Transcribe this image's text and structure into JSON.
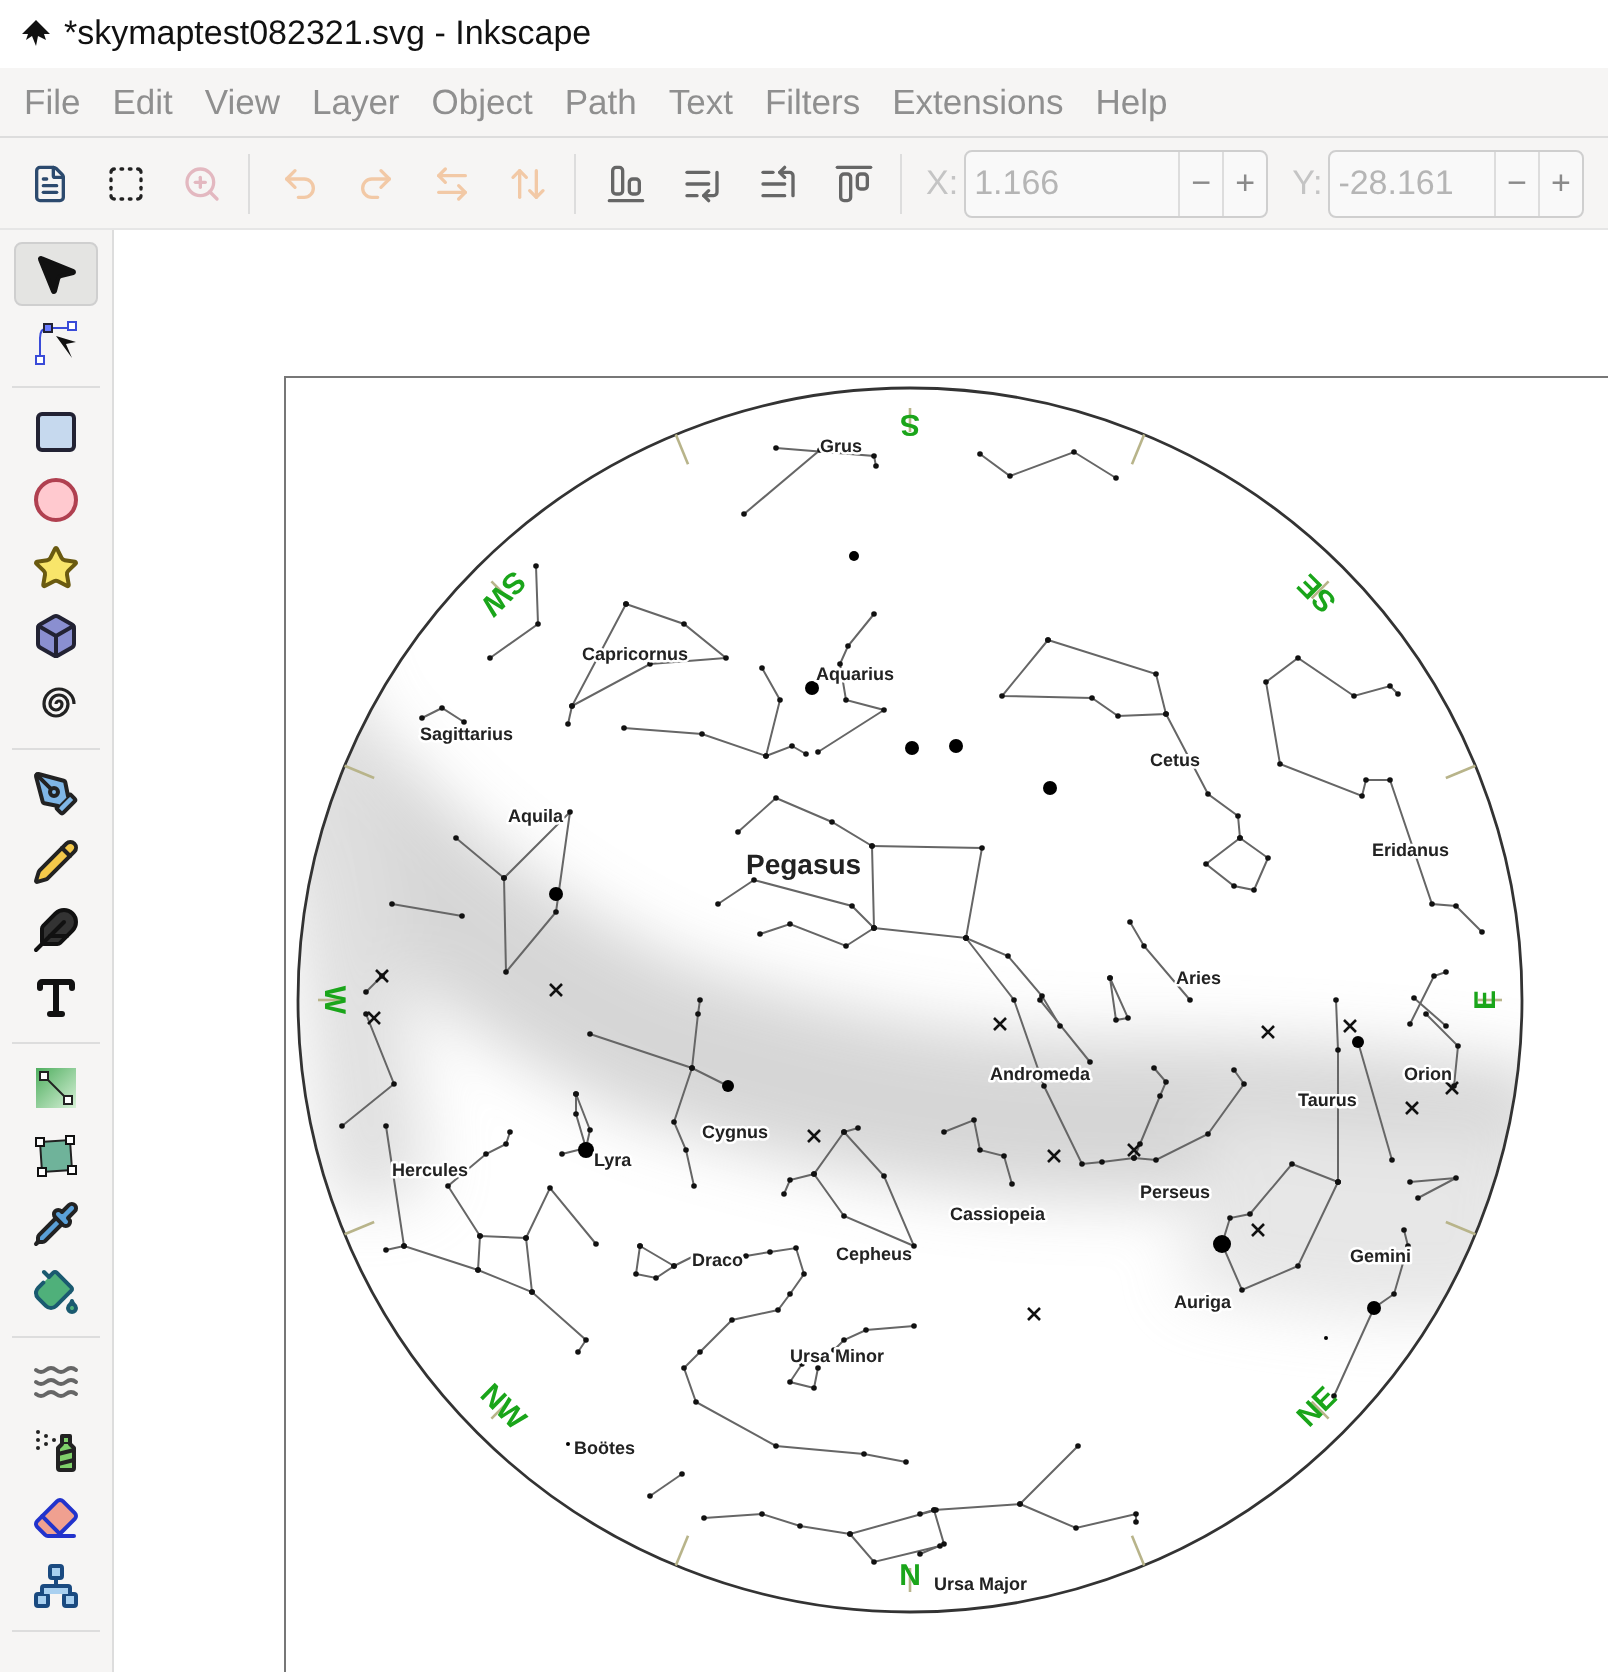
{
  "window": {
    "title": "*skymaptest082321.svg - Inkscape"
  },
  "menu": [
    "File",
    "Edit",
    "View",
    "Layer",
    "Object",
    "Path",
    "Text",
    "Filters",
    "Extensions",
    "Help"
  ],
  "toolbar": {
    "groups": [
      [
        {
          "kind": "document-properties",
          "disabled": false
        },
        {
          "kind": "select-all",
          "disabled": false
        },
        {
          "kind": "zoom-selection",
          "disabled": true
        }
      ],
      [
        {
          "kind": "rotate-left",
          "disabled": true
        },
        {
          "kind": "rotate-right",
          "disabled": true
        },
        {
          "kind": "flip-horizontal",
          "disabled": true
        },
        {
          "kind": "flip-vertical",
          "disabled": true
        }
      ],
      [
        {
          "kind": "lower-bottom",
          "disabled": false
        },
        {
          "kind": "lower",
          "disabled": false
        },
        {
          "kind": "raise",
          "disabled": false
        },
        {
          "kind": "raise-top",
          "disabled": false
        }
      ]
    ],
    "fields": [
      {
        "label": "X:",
        "value": "1.166",
        "decrement": "−",
        "increment": "+",
        "disabled": true
      },
      {
        "label": "Y:",
        "value": "-28.161",
        "decrement": "−",
        "increment": "+",
        "disabled": true
      }
    ]
  },
  "tools": [
    [
      {
        "kind": "selector",
        "selected": true
      },
      {
        "kind": "node",
        "selected": false
      }
    ],
    [
      {
        "kind": "rectangle",
        "selected": false
      },
      {
        "kind": "ellipse",
        "selected": false
      },
      {
        "kind": "star",
        "selected": false
      },
      {
        "kind": "box3d",
        "selected": false
      },
      {
        "kind": "spiral",
        "selected": false
      }
    ],
    [
      {
        "kind": "pen",
        "selected": false
      },
      {
        "kind": "pencil",
        "selected": false
      },
      {
        "kind": "calligraphy",
        "selected": false
      },
      {
        "kind": "text",
        "selected": false
      }
    ],
    [
      {
        "kind": "gradient",
        "selected": false
      },
      {
        "kind": "mesh",
        "selected": false
      },
      {
        "kind": "dropper",
        "selected": false
      },
      {
        "kind": "bucket",
        "selected": false
      }
    ],
    [
      {
        "kind": "tweak",
        "selected": false
      },
      {
        "kind": "spray",
        "selected": false
      },
      {
        "kind": "eraser",
        "selected": false
      },
      {
        "kind": "connector",
        "selected": false
      }
    ]
  ],
  "canvas": {
    "compass": [
      "S",
      "SW",
      "SE",
      "W",
      "E",
      "NW",
      "NE",
      "N"
    ],
    "constellations": [
      {
        "label": "Grus",
        "major": false
      },
      {
        "label": "Capricornus",
        "major": false
      },
      {
        "label": "Aquarius",
        "major": false
      },
      {
        "label": "Sagittarius",
        "major": false
      },
      {
        "label": "Cetus",
        "major": false
      },
      {
        "label": "Aquila",
        "major": false
      },
      {
        "label": "Pegasus",
        "major": true
      },
      {
        "label": "Eridanus",
        "major": false
      },
      {
        "label": "Aries",
        "major": false
      },
      {
        "label": "Andromeda",
        "major": false
      },
      {
        "label": "Orion",
        "major": false
      },
      {
        "label": "Taurus",
        "major": false
      },
      {
        "label": "Cygnus",
        "major": false
      },
      {
        "label": "Lyra",
        "major": false
      },
      {
        "label": "Hercules",
        "major": false
      },
      {
        "label": "Perseus",
        "major": false
      },
      {
        "label": "Cassiopeia",
        "major": false
      },
      {
        "label": "Draco",
        "major": false
      },
      {
        "label": "Cepheus",
        "major": false
      },
      {
        "label": "Gemini",
        "major": false
      },
      {
        "label": "Auriga",
        "major": false
      },
      {
        "label": "Ursa Minor",
        "major": false
      },
      {
        "label": "Boötes",
        "major": false
      },
      {
        "label": "Ursa Major",
        "major": false
      }
    ]
  }
}
